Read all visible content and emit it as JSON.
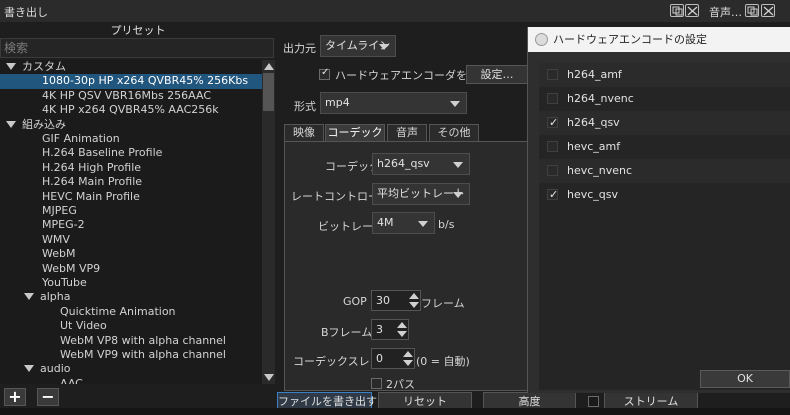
{
  "window": {
    "title": "書き出し",
    "audio_label": "音声…"
  },
  "left": {
    "header": "プリセット",
    "search_placeholder": "検索",
    "tree": [
      {
        "label": "カスタム",
        "depth": 0,
        "caret": true
      },
      {
        "label": "1080-30p HP x264 QVBR45% 256Kbs",
        "depth": 2,
        "selected": true
      },
      {
        "label": "4K HP QSV VBR16Mbs 256AAC",
        "depth": 2
      },
      {
        "label": "4K HP x264 QVBR45% AAC256k",
        "depth": 2
      },
      {
        "label": "組み込み",
        "depth": 0,
        "caret": true
      },
      {
        "label": "GIF Animation",
        "depth": 2
      },
      {
        "label": "H.264 Baseline Profile",
        "depth": 2
      },
      {
        "label": "H.264 High Profile",
        "depth": 2
      },
      {
        "label": "H.264 Main Profile",
        "depth": 2
      },
      {
        "label": "HEVC Main Profile",
        "depth": 2
      },
      {
        "label": "MJPEG",
        "depth": 2
      },
      {
        "label": "MPEG-2",
        "depth": 2
      },
      {
        "label": "WMV",
        "depth": 2
      },
      {
        "label": "WebM",
        "depth": 2
      },
      {
        "label": "WebM VP9",
        "depth": 2
      },
      {
        "label": "YouTube",
        "depth": 2
      },
      {
        "label": "alpha",
        "depth": 1,
        "caret": true
      },
      {
        "label": "Quicktime Animation",
        "depth": 3
      },
      {
        "label": "Ut Video",
        "depth": 3
      },
      {
        "label": "WebM VP8 with alpha channel",
        "depth": 3
      },
      {
        "label": "WebM VP9 with alpha channel",
        "depth": 3
      },
      {
        "label": "audio",
        "depth": 1,
        "caret": true
      },
      {
        "label": "AAC",
        "depth": 3
      }
    ],
    "add_label": "+",
    "remove_label": "−"
  },
  "center": {
    "output_label": "出力元",
    "output_value": "タイムライン",
    "hw_encoder_label": "ハードウェアエンコーダを使用",
    "hw_encoder_checked": true,
    "settings_button": "設定…",
    "format_label": "形式",
    "format_value": "mp4",
    "tabs": [
      "映像",
      "コーデック",
      "音声",
      "その他"
    ],
    "active_tab": 1,
    "codec_label": "コーデック",
    "codec_value": "h264_qsv",
    "ratecontrol_label": "レートコントロール",
    "ratecontrol_value": "平均ビットレート",
    "bitrate_label": "ビットレート",
    "bitrate_value": "4M",
    "bitrate_unit": "b/s",
    "gop_label": "GOP",
    "gop_value": "30",
    "gop_unit": "フレーム",
    "bframes_label": "Bフレーム",
    "bframes_value": "3",
    "threads_label": "コーデックスレッド",
    "threads_value": "0",
    "threads_hint": "(0 = 自動)",
    "twopass_label": "2パス",
    "twopass_checked": false
  },
  "bottom": {
    "export_file": "ファイルを書き出す",
    "reset": "リセット",
    "advanced": "高度",
    "stream": "ストリーム"
  },
  "dialog": {
    "title": "ハードウェアエンコードの設定",
    "items": [
      {
        "label": "h264_amf",
        "checked": false
      },
      {
        "label": "h264_nvenc",
        "checked": false
      },
      {
        "label": "h264_qsv",
        "checked": true
      },
      {
        "label": "hevc_amf",
        "checked": false
      },
      {
        "label": "hevc_nvenc",
        "checked": false
      },
      {
        "label": "hevc_qsv",
        "checked": true
      }
    ],
    "ok_label": "OK"
  },
  "icons": {
    "window_buttons": [
      "restore-icon",
      "close-icon"
    ],
    "check_mark": "✓"
  },
  "colors": {
    "selection": "#21567e",
    "background": "#1e1e1e",
    "panel": "#2a2a2a",
    "dialog_title_bg": "#f3f3f3"
  }
}
